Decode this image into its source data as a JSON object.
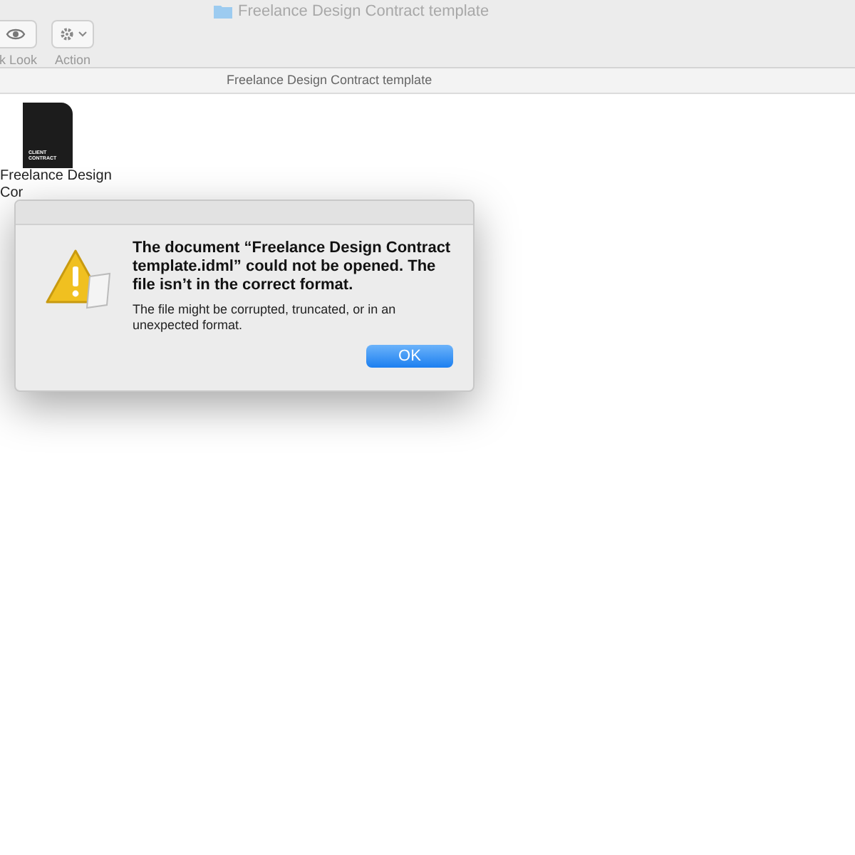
{
  "window": {
    "title": "Freelance Design Contract template"
  },
  "toolbar": [
    {
      "kind": "eye",
      "label": "k Look"
    },
    {
      "kind": "gear",
      "label": "Action"
    }
  ],
  "path_bar": {
    "title": "Freelance Design Contract template"
  },
  "files": [
    {
      "label_lines": [
        "Freelance Design",
        "Cor"
      ],
      "thumbnail_text": "CLIENT CONTRACT"
    }
  ],
  "alert": {
    "message": "The document “Freelance Design Contract template.idml” could not be opened. The file isn’t in the correct format.",
    "informative": "The file might be corrupted, truncated, or in an unexpected format.",
    "buttons": [
      "OK"
    ]
  }
}
